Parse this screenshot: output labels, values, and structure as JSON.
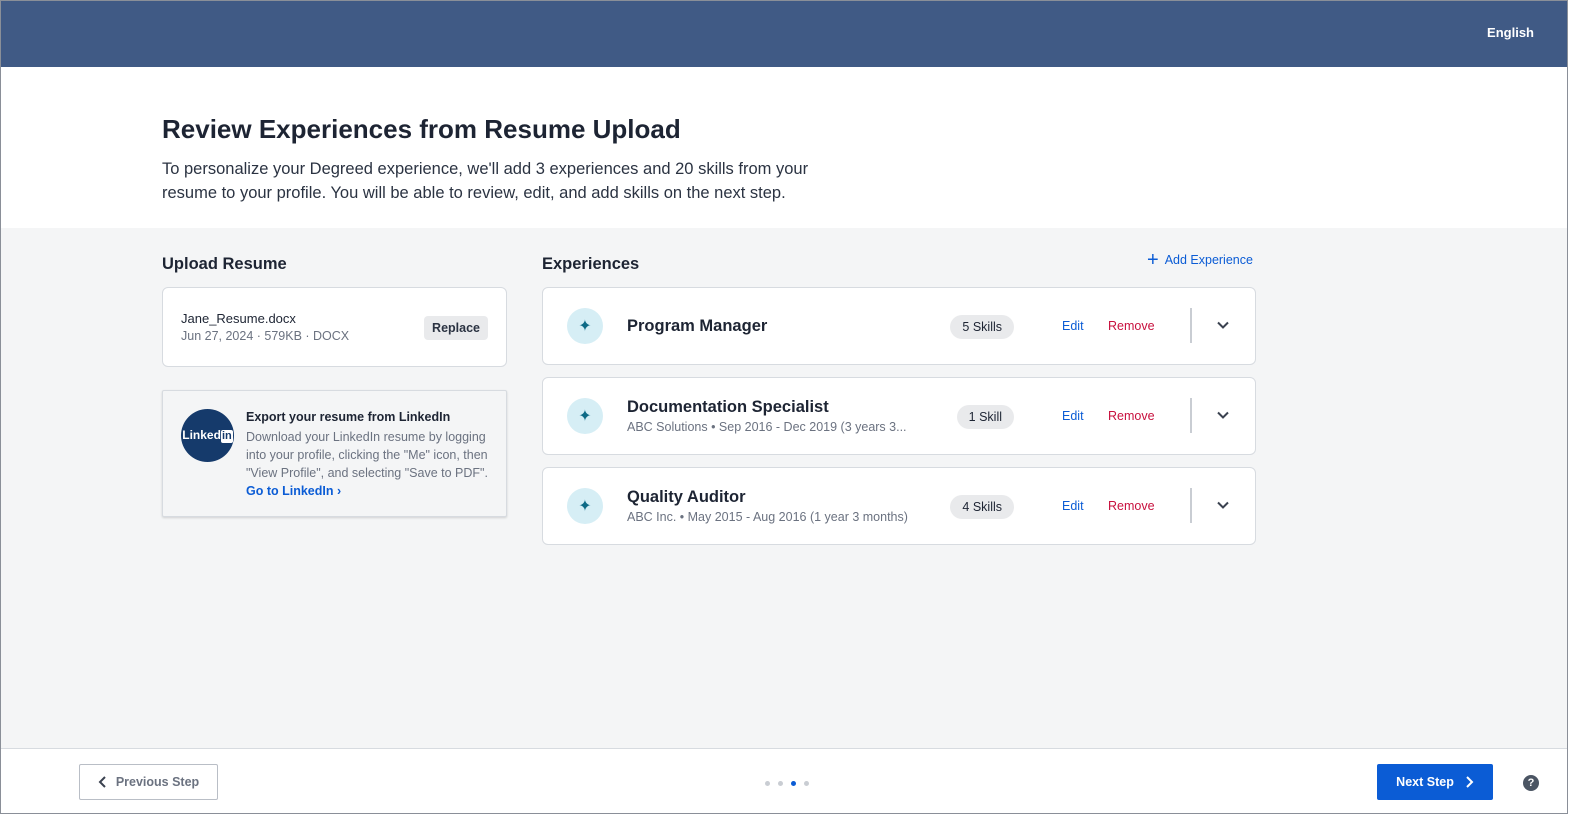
{
  "header": {
    "language": "English"
  },
  "hero": {
    "title": "Review Experiences from Resume Upload",
    "description": "To personalize your Degreed experience, we'll add 3 experiences and 20 skills from your resume to your profile. You will be able to review, edit, and add skills on the next step."
  },
  "upload": {
    "section_title": "Upload Resume",
    "file_name": "Jane_Resume.docx",
    "file_meta": "Jun 27, 2024 · 579KB · DOCX",
    "replace_label": "Replace"
  },
  "linkedin": {
    "logo_text": "Linked",
    "logo_in": "in",
    "title": "Export your resume from LinkedIn",
    "text": "Download your LinkedIn resume by logging into your profile, clicking the \"Me\" icon, then \"View Profile\", and selecting \"Save to PDF\".",
    "link_label": "Go to LinkedIn ›"
  },
  "experiences": {
    "section_title": "Experiences",
    "add_label": "Add Experience",
    "edit_label": "Edit",
    "remove_label": "Remove",
    "items": [
      {
        "title": "Program Manager",
        "subtitle": "",
        "skills": "5 Skills"
      },
      {
        "title": "Documentation Specialist",
        "subtitle": "ABC Solutions • Sep 2016 - Dec 2019 (3 years 3...",
        "skills": "1 Skill"
      },
      {
        "title": "Quality Auditor",
        "subtitle": "ABC Inc. • May 2015 - Aug 2016 (1 year 3 months)",
        "skills": "4 Skills"
      }
    ]
  },
  "footer": {
    "prev_label": "Previous Step",
    "next_label": "Next Step",
    "step_current": 3,
    "step_total": 4,
    "help_glyph": "?"
  },
  "colors": {
    "topbar": "#405a85",
    "primary": "#0b5cd5",
    "danger": "#c8103e"
  }
}
